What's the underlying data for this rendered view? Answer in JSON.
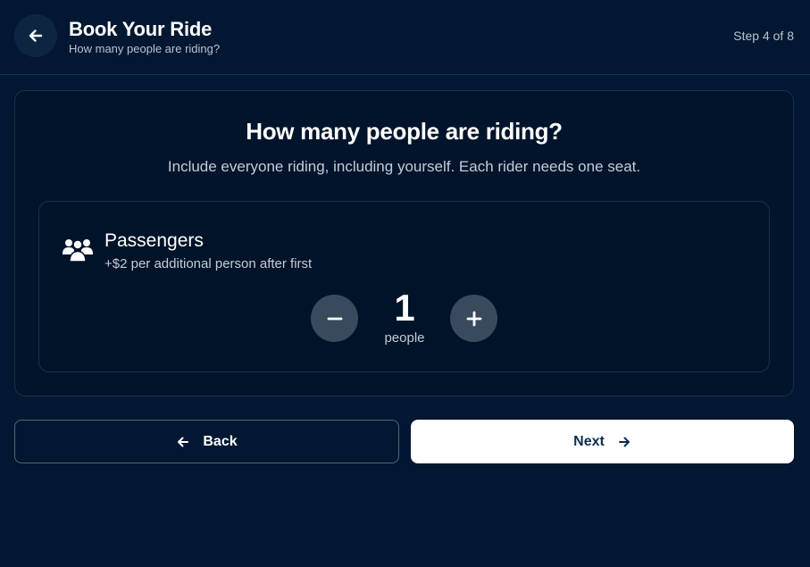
{
  "header": {
    "title": "Book Your Ride",
    "subtitle": "How many people are riding?",
    "step_indicator": "Step 4 of 8",
    "back_icon": "arrow-left-icon"
  },
  "main": {
    "question": "How many people are riding?",
    "instruction": "Include everyone riding, including yourself. Each rider needs one seat.",
    "passengers": {
      "icon": "people-group-icon",
      "label": "Passengers",
      "pricing_note": "+$2 per additional person after first",
      "count": "1",
      "unit": "people",
      "decrement_icon": "minus-icon",
      "increment_icon": "plus-icon"
    }
  },
  "navigation": {
    "back_label": "Back",
    "next_label": "Next"
  },
  "colors": {
    "background": "#021731",
    "card": "#01142b",
    "border": "#16304d",
    "stepper_button": "#3a4a5d",
    "primary_button": "#ffffff",
    "primary_text": "#0d2d52"
  }
}
